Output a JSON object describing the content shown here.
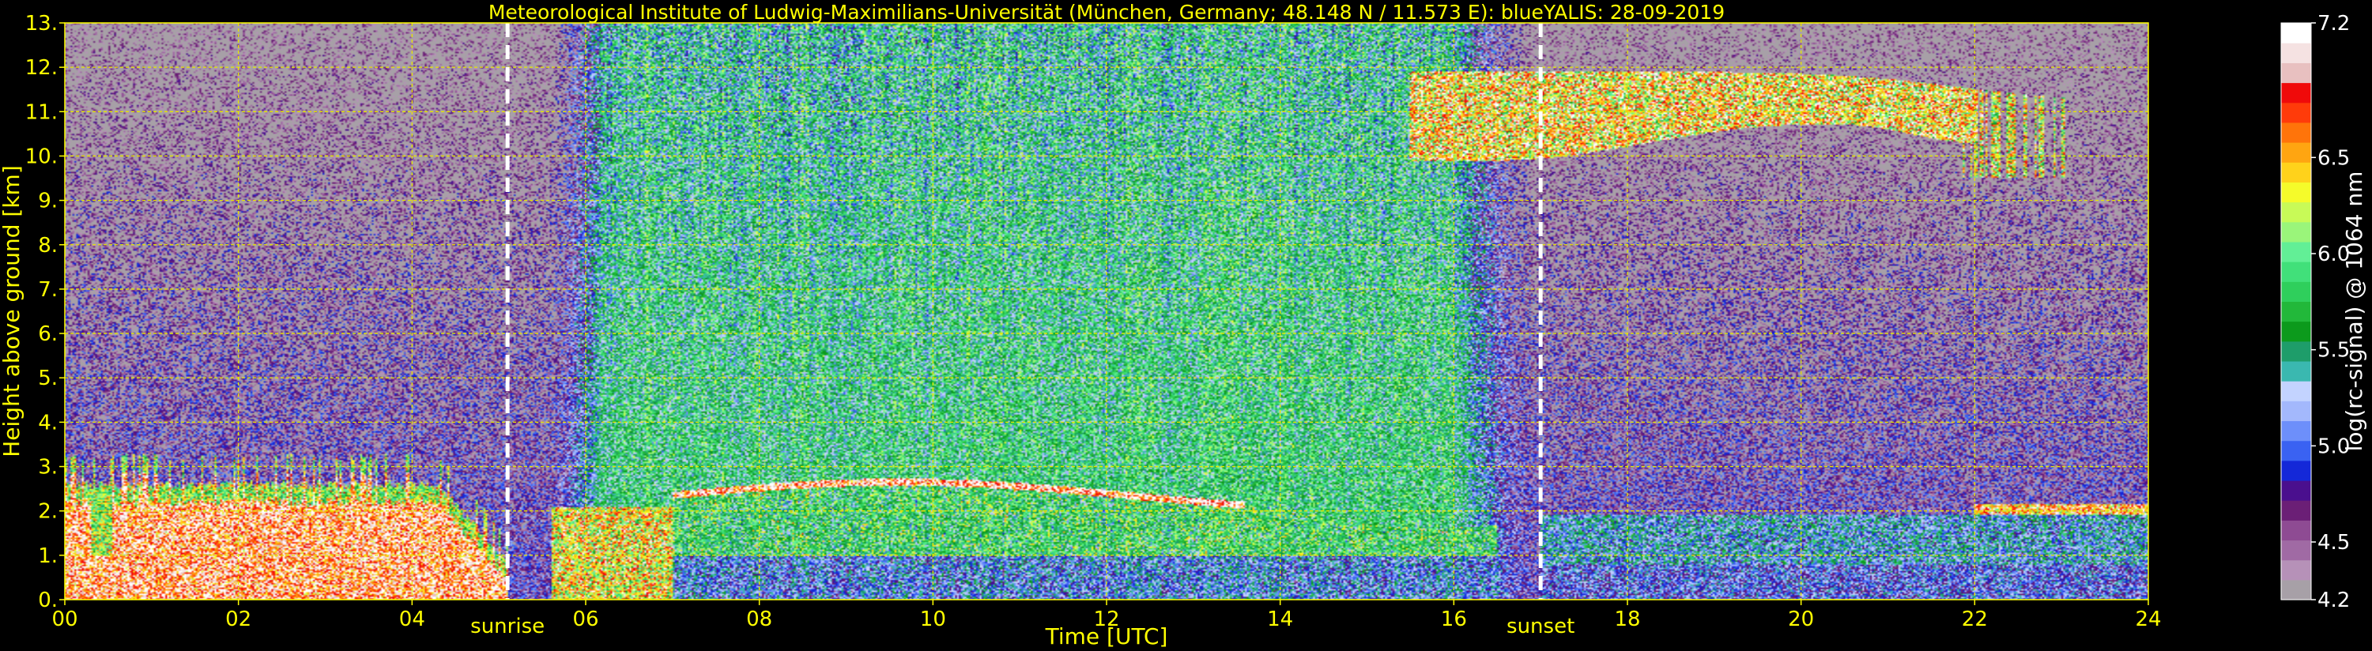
{
  "chart_data": {
    "type": "heatmap",
    "title": "Meteorological Institute of Ludwig-Maximilians-Universität (München, Germany; 48.148 N / 11.573 E):     blueYALIS: 28-09-2019",
    "xlabel": "Time [UTC]",
    "ylabel": "Height above ground [km]",
    "xlim": [
      0,
      24
    ],
    "ylim": [
      0,
      13
    ],
    "x_ticks": [
      "00",
      "02",
      "04",
      "06",
      "08",
      "10",
      "12",
      "14",
      "16",
      "18",
      "20",
      "22",
      "24"
    ],
    "y_ticks": [
      "0.",
      "1.",
      "2.",
      "3.",
      "4.",
      "5.",
      "6.",
      "7.",
      "8.",
      "9.",
      "10.",
      "11.",
      "12.",
      "13."
    ],
    "grid": true,
    "colorbar": {
      "label": "log(rc-signal) @ 1064 nm",
      "range": [
        4.2,
        7.2
      ],
      "ticks": [
        "4.2",
        "4.5",
        "5.0",
        "5.5",
        "6.0",
        "6.5",
        "7.2"
      ],
      "colors": [
        "#a7a0a7",
        "#b691b8",
        "#a06aa4",
        "#8e4b93",
        "#6b1f76",
        "#4a0f8e",
        "#1428d8",
        "#3a62f2",
        "#6d8ffa",
        "#a3b8fc",
        "#c3d3ff",
        "#3ab8b0",
        "#1e9d6a",
        "#0c9a1c",
        "#22b83a",
        "#2fcf5c",
        "#41e07a",
        "#62ef96",
        "#9af57a",
        "#c8fa57",
        "#f5fb2a",
        "#ffd21b",
        "#ffa511",
        "#ff740a",
        "#ff3b0a",
        "#f00a0a",
        "#e8c0c0",
        "#f5e2e2",
        "#ffffff"
      ]
    },
    "events": [
      {
        "label": "sunrise",
        "time_utc": 5.1
      },
      {
        "label": "sunset",
        "time_utc": 17.0
      }
    ]
  }
}
